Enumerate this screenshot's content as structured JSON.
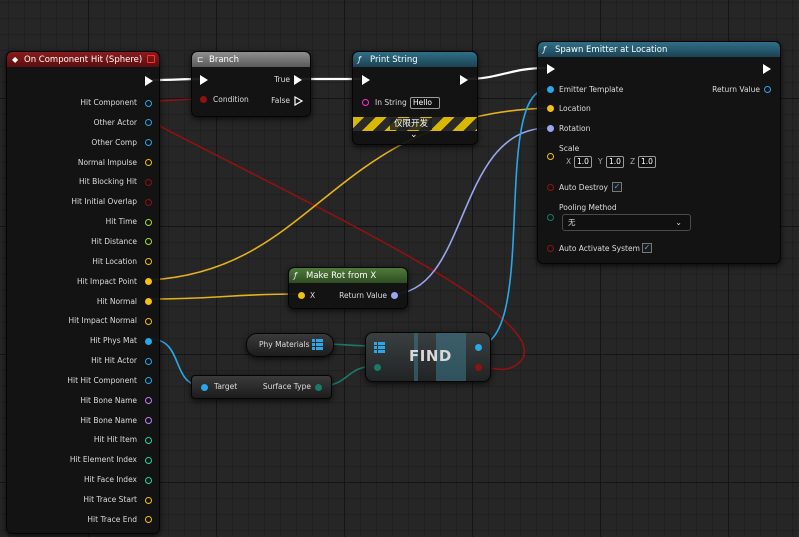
{
  "colors": {
    "exec": "#ffffff",
    "object": "#2aa7e8",
    "vector": "#f2c012",
    "rotator": "#9aa5f2",
    "bool": "#8f1212",
    "float": "#9ee22a",
    "name": "#c27bff",
    "int": "#1fd6a0",
    "string": "#ff2fd1",
    "struct": "#1a7a6a"
  },
  "nodes": {
    "event": {
      "title": "On Component Hit (Sphere)",
      "pins": [
        "Hit Component",
        "Other Actor",
        "Other Comp",
        "Normal Impulse",
        "Hit Blocking Hit",
        "Hit Initial Overlap",
        "Hit Time",
        "Hit Distance",
        "Hit Location",
        "Hit Impact Point",
        "Hit Normal",
        "Hit Impact Normal",
        "Hit Phys Mat",
        "Hit Hit Actor",
        "Hit Hit Component",
        "Hit Bone Name",
        "Hit Bone Name",
        "Hit Hit Item",
        "Hit Element Index",
        "Hit Face Index",
        "Hit Trace Start",
        "Hit Trace End"
      ]
    },
    "branch": {
      "title": "Branch",
      "condition": "Condition",
      "true_label": "True",
      "false_label": "False"
    },
    "print": {
      "title": "Print String",
      "in_string_label": "In String",
      "in_string_value": "Hello",
      "dev_only": "仅限开发"
    },
    "spawn": {
      "title": "Spawn Emitter at Location",
      "emitter_template": "Emitter Template",
      "return_value": "Return Value",
      "location": "Location",
      "rotation": "Rotation",
      "scale": "Scale",
      "scale_x_label": "X",
      "scale_x": "1.0",
      "scale_y_label": "Y",
      "scale_y": "1.0",
      "scale_z_label": "Z",
      "scale_z": "1.0",
      "auto_destroy": "Auto Destroy",
      "pooling_method": "Pooling Method",
      "pooling_value": "无",
      "auto_activate": "Auto Activate System"
    },
    "makerot": {
      "title": "Make Rot from X",
      "x_label": "X",
      "return_value": "Return Value"
    },
    "phymat": {
      "label": "Phy Materials"
    },
    "find": {
      "label": "FIND"
    },
    "surface": {
      "target": "Target",
      "surface_type": "Surface Type"
    }
  }
}
